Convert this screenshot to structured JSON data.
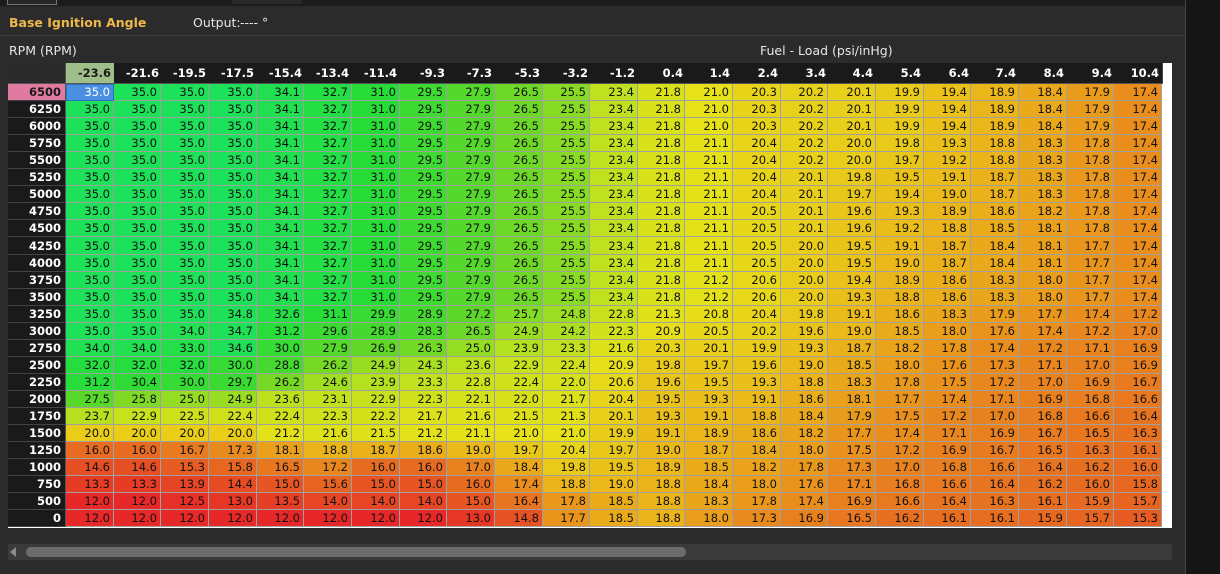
{
  "header": {
    "title": "Base Ignition Angle",
    "output_label": "Output:",
    "output_value": "---- °"
  },
  "axis": {
    "row_label": "RPM (RPM)",
    "col_label": "Fuel - Load (psi/inHg)"
  },
  "selection": {
    "row": 0,
    "col": 0
  },
  "columns": [
    "-23.6",
    "-21.6",
    "-19.5",
    "-17.5",
    "-15.4",
    "-13.4",
    "-11.4",
    "-9.3",
    "-7.3",
    "-5.3",
    "-3.2",
    "-1.2",
    "0.4",
    "1.4",
    "2.4",
    "3.4",
    "4.4",
    "5.4",
    "6.4",
    "7.4",
    "8.4",
    "9.4",
    "10.4"
  ],
  "rows": [
    "6500",
    "6250",
    "6000",
    "5750",
    "5500",
    "5250",
    "5000",
    "4750",
    "4500",
    "4250",
    "4000",
    "3750",
    "3500",
    "3250",
    "3000",
    "2750",
    "2500",
    "2250",
    "2000",
    "1750",
    "1500",
    "1250",
    "1000",
    "750",
    "500",
    "0"
  ],
  "table": [
    [
      "35.0",
      "35.0",
      "35.0",
      "35.0",
      "34.1",
      "32.7",
      "31.0",
      "29.5",
      "27.9",
      "26.5",
      "25.5",
      "23.4",
      "21.8",
      "21.0",
      "20.3",
      "20.2",
      "20.1",
      "19.9",
      "19.4",
      "18.9",
      "18.4",
      "17.9",
      "17.4"
    ],
    [
      "35.0",
      "35.0",
      "35.0",
      "35.0",
      "34.1",
      "32.7",
      "31.0",
      "29.5",
      "27.9",
      "26.5",
      "25.5",
      "23.4",
      "21.8",
      "21.0",
      "20.3",
      "20.2",
      "20.1",
      "19.9",
      "19.4",
      "18.9",
      "18.4",
      "17.9",
      "17.4"
    ],
    [
      "35.0",
      "35.0",
      "35.0",
      "35.0",
      "34.1",
      "32.7",
      "31.0",
      "29.5",
      "27.9",
      "26.5",
      "25.5",
      "23.4",
      "21.8",
      "21.0",
      "20.3",
      "20.2",
      "20.1",
      "19.9",
      "19.4",
      "18.9",
      "18.4",
      "17.9",
      "17.4"
    ],
    [
      "35.0",
      "35.0",
      "35.0",
      "35.0",
      "34.1",
      "32.7",
      "31.0",
      "29.5",
      "27.9",
      "26.5",
      "25.5",
      "23.4",
      "21.8",
      "21.1",
      "20.4",
      "20.2",
      "20.0",
      "19.8",
      "19.3",
      "18.8",
      "18.3",
      "17.8",
      "17.4"
    ],
    [
      "35.0",
      "35.0",
      "35.0",
      "35.0",
      "34.1",
      "32.7",
      "31.0",
      "29.5",
      "27.9",
      "26.5",
      "25.5",
      "23.4",
      "21.8",
      "21.1",
      "20.4",
      "20.2",
      "20.0",
      "19.7",
      "19.2",
      "18.8",
      "18.3",
      "17.8",
      "17.4"
    ],
    [
      "35.0",
      "35.0",
      "35.0",
      "35.0",
      "34.1",
      "32.7",
      "31.0",
      "29.5",
      "27.9",
      "26.5",
      "25.5",
      "23.4",
      "21.8",
      "21.1",
      "20.4",
      "20.1",
      "19.8",
      "19.5",
      "19.1",
      "18.7",
      "18.3",
      "17.8",
      "17.4"
    ],
    [
      "35.0",
      "35.0",
      "35.0",
      "35.0",
      "34.1",
      "32.7",
      "31.0",
      "29.5",
      "27.9",
      "26.5",
      "25.5",
      "23.4",
      "21.8",
      "21.1",
      "20.4",
      "20.1",
      "19.7",
      "19.4",
      "19.0",
      "18.7",
      "18.3",
      "17.8",
      "17.4"
    ],
    [
      "35.0",
      "35.0",
      "35.0",
      "35.0",
      "34.1",
      "32.7",
      "31.0",
      "29.5",
      "27.9",
      "26.5",
      "25.5",
      "23.4",
      "21.8",
      "21.1",
      "20.5",
      "20.1",
      "19.6",
      "19.3",
      "18.9",
      "18.6",
      "18.2",
      "17.8",
      "17.4"
    ],
    [
      "35.0",
      "35.0",
      "35.0",
      "35.0",
      "34.1",
      "32.7",
      "31.0",
      "29.5",
      "27.9",
      "26.5",
      "25.5",
      "23.4",
      "21.8",
      "21.1",
      "20.5",
      "20.1",
      "19.6",
      "19.2",
      "18.8",
      "18.5",
      "18.1",
      "17.8",
      "17.4"
    ],
    [
      "35.0",
      "35.0",
      "35.0",
      "35.0",
      "34.1",
      "32.7",
      "31.0",
      "29.5",
      "27.9",
      "26.5",
      "25.5",
      "23.4",
      "21.8",
      "21.1",
      "20.5",
      "20.0",
      "19.5",
      "19.1",
      "18.7",
      "18.4",
      "18.1",
      "17.7",
      "17.4"
    ],
    [
      "35.0",
      "35.0",
      "35.0",
      "35.0",
      "34.1",
      "32.7",
      "31.0",
      "29.5",
      "27.9",
      "26.5",
      "25.5",
      "23.4",
      "21.8",
      "21.1",
      "20.5",
      "20.0",
      "19.5",
      "19.0",
      "18.7",
      "18.4",
      "18.1",
      "17.7",
      "17.4"
    ],
    [
      "35.0",
      "35.0",
      "35.0",
      "35.0",
      "34.1",
      "32.7",
      "31.0",
      "29.5",
      "27.9",
      "26.5",
      "25.5",
      "23.4",
      "21.8",
      "21.2",
      "20.6",
      "20.0",
      "19.4",
      "18.9",
      "18.6",
      "18.3",
      "18.0",
      "17.7",
      "17.4"
    ],
    [
      "35.0",
      "35.0",
      "35.0",
      "35.0",
      "34.1",
      "32.7",
      "31.0",
      "29.5",
      "27.9",
      "26.5",
      "25.5",
      "23.4",
      "21.8",
      "21.2",
      "20.6",
      "20.0",
      "19.3",
      "18.8",
      "18.6",
      "18.3",
      "18.0",
      "17.7",
      "17.4"
    ],
    [
      "35.0",
      "35.0",
      "35.0",
      "34.8",
      "32.6",
      "31.1",
      "29.9",
      "28.9",
      "27.2",
      "25.7",
      "24.8",
      "22.8",
      "21.3",
      "20.8",
      "20.4",
      "19.8",
      "19.1",
      "18.6",
      "18.3",
      "17.9",
      "17.7",
      "17.4",
      "17.2"
    ],
    [
      "35.0",
      "35.0",
      "34.0",
      "34.7",
      "31.2",
      "29.6",
      "28.9",
      "28.3",
      "26.5",
      "24.9",
      "24.2",
      "22.3",
      "20.9",
      "20.5",
      "20.2",
      "19.6",
      "19.0",
      "18.5",
      "18.0",
      "17.6",
      "17.4",
      "17.2",
      "17.0"
    ],
    [
      "34.0",
      "34.0",
      "33.0",
      "34.6",
      "30.0",
      "27.9",
      "26.9",
      "26.3",
      "25.0",
      "23.9",
      "23.3",
      "21.6",
      "20.3",
      "20.1",
      "19.9",
      "19.3",
      "18.7",
      "18.2",
      "17.8",
      "17.4",
      "17.2",
      "17.1",
      "16.9"
    ],
    [
      "32.0",
      "32.0",
      "32.0",
      "30.0",
      "28.8",
      "26.2",
      "24.9",
      "24.3",
      "23.6",
      "22.9",
      "22.4",
      "20.9",
      "19.8",
      "19.7",
      "19.6",
      "19.0",
      "18.5",
      "18.0",
      "17.6",
      "17.3",
      "17.1",
      "17.0",
      "16.9"
    ],
    [
      "31.2",
      "30.4",
      "30.0",
      "29.7",
      "26.2",
      "24.6",
      "23.9",
      "23.3",
      "22.8",
      "22.4",
      "22.0",
      "20.6",
      "19.6",
      "19.5",
      "19.3",
      "18.8",
      "18.3",
      "17.8",
      "17.5",
      "17.2",
      "17.0",
      "16.9",
      "16.7"
    ],
    [
      "27.5",
      "25.8",
      "25.0",
      "24.9",
      "23.6",
      "23.1",
      "22.9",
      "22.3",
      "22.1",
      "22.0",
      "21.7",
      "20.4",
      "19.5",
      "19.3",
      "19.1",
      "18.6",
      "18.1",
      "17.7",
      "17.4",
      "17.1",
      "16.9",
      "16.8",
      "16.6"
    ],
    [
      "23.7",
      "22.9",
      "22.5",
      "22.4",
      "22.4",
      "22.3",
      "22.2",
      "21.7",
      "21.6",
      "21.5",
      "21.3",
      "20.1",
      "19.3",
      "19.1",
      "18.8",
      "18.4",
      "17.9",
      "17.5",
      "17.2",
      "17.0",
      "16.8",
      "16.6",
      "16.4"
    ],
    [
      "20.0",
      "20.0",
      "20.0",
      "20.0",
      "21.2",
      "21.6",
      "21.5",
      "21.2",
      "21.1",
      "21.0",
      "21.0",
      "19.9",
      "19.1",
      "18.9",
      "18.6",
      "18.2",
      "17.7",
      "17.4",
      "17.1",
      "16.9",
      "16.7",
      "16.5",
      "16.3"
    ],
    [
      "16.0",
      "16.0",
      "16.7",
      "17.3",
      "18.1",
      "18.8",
      "18.7",
      "18.6",
      "19.0",
      "19.7",
      "20.4",
      "19.7",
      "19.0",
      "18.7",
      "18.4",
      "18.0",
      "17.5",
      "17.2",
      "16.9",
      "16.7",
      "16.5",
      "16.3",
      "16.1"
    ],
    [
      "14.6",
      "14.6",
      "15.3",
      "15.8",
      "16.5",
      "17.2",
      "16.0",
      "16.0",
      "17.0",
      "18.4",
      "19.8",
      "19.5",
      "18.9",
      "18.5",
      "18.2",
      "17.8",
      "17.3",
      "17.0",
      "16.8",
      "16.6",
      "16.4",
      "16.2",
      "16.0"
    ],
    [
      "13.3",
      "13.3",
      "13.9",
      "14.4",
      "15.0",
      "15.6",
      "15.0",
      "15.0",
      "16.0",
      "17.4",
      "18.8",
      "19.0",
      "18.8",
      "18.4",
      "18.0",
      "17.6",
      "17.1",
      "16.8",
      "16.6",
      "16.4",
      "16.2",
      "16.0",
      "15.8"
    ],
    [
      "12.0",
      "12.0",
      "12.5",
      "13.0",
      "13.5",
      "14.0",
      "14.0",
      "14.0",
      "15.0",
      "16.4",
      "17.8",
      "18.5",
      "18.8",
      "18.3",
      "17.8",
      "17.4",
      "16.9",
      "16.6",
      "16.4",
      "16.3",
      "16.1",
      "15.9",
      "15.7"
    ],
    [
      "12.0",
      "12.0",
      "12.0",
      "12.0",
      "12.0",
      "12.0",
      "12.0",
      "12.0",
      "13.0",
      "14.8",
      "17.7",
      "18.5",
      "18.8",
      "18.0",
      "17.3",
      "16.9",
      "16.5",
      "16.2",
      "16.1",
      "16.1",
      "15.9",
      "15.7",
      "15.3"
    ]
  ],
  "colors": {
    "title": "#f0b84a",
    "selected_column_header": "#9fbf8a",
    "selected_row_header": "#e07aa0",
    "selected_cell": "#4a90e2"
  }
}
